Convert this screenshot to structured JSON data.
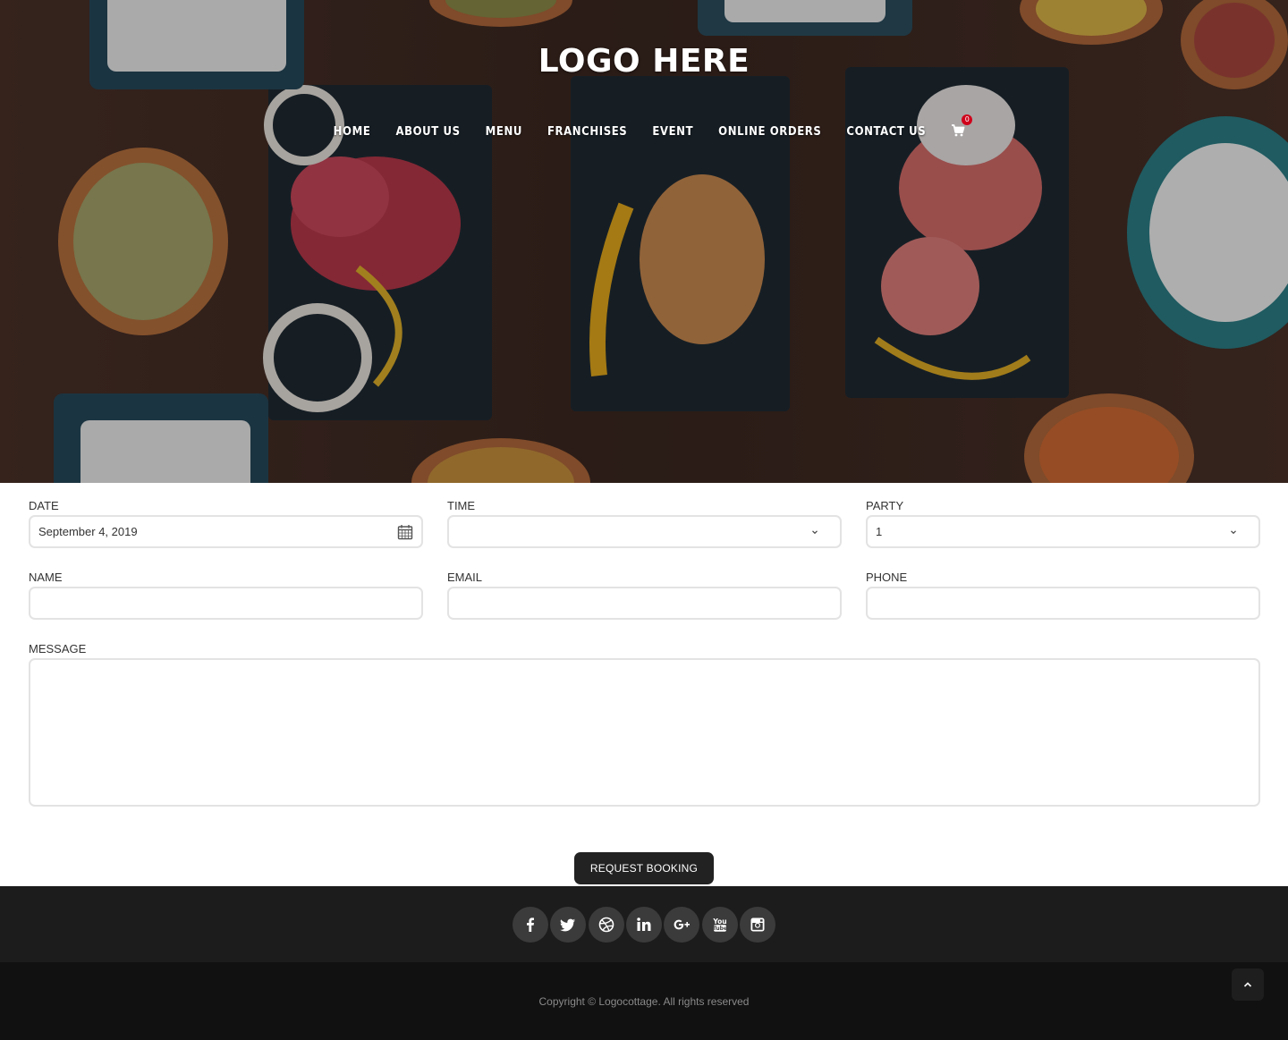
{
  "header": {
    "logo": "LOGO HERE",
    "nav": [
      {
        "label": "HOME"
      },
      {
        "label": "ABOUT US"
      },
      {
        "label": "MENU"
      },
      {
        "label": "FRANCHISES"
      },
      {
        "label": "EVENT"
      },
      {
        "label": "ONLINE ORDERS"
      },
      {
        "label": "CONTACT US"
      }
    ],
    "cart_count": "0"
  },
  "form": {
    "date": {
      "label": "DATE",
      "value": "September 4, 2019"
    },
    "time": {
      "label": "TIME",
      "value": ""
    },
    "party": {
      "label": "PARTY",
      "value": "1"
    },
    "name": {
      "label": "NAME",
      "value": ""
    },
    "email": {
      "label": "EMAIL",
      "value": ""
    },
    "phone": {
      "label": "PHONE",
      "value": ""
    },
    "message": {
      "label": "MESSAGE",
      "value": ""
    },
    "submit_label": "REQUEST BOOKING"
  },
  "footer": {
    "social": [
      "facebook-icon",
      "twitter-icon",
      "dribbble-icon",
      "linkedin-icon",
      "google-plus-icon",
      "youtube-icon",
      "instagram-icon"
    ],
    "copyright": "Copyright © Logocottage. All rights reserved"
  },
  "colors": {
    "button_bg": "#222222",
    "footer_top": "#1c1c1c",
    "footer_bottom": "#111111",
    "badge": "#d0021b"
  }
}
